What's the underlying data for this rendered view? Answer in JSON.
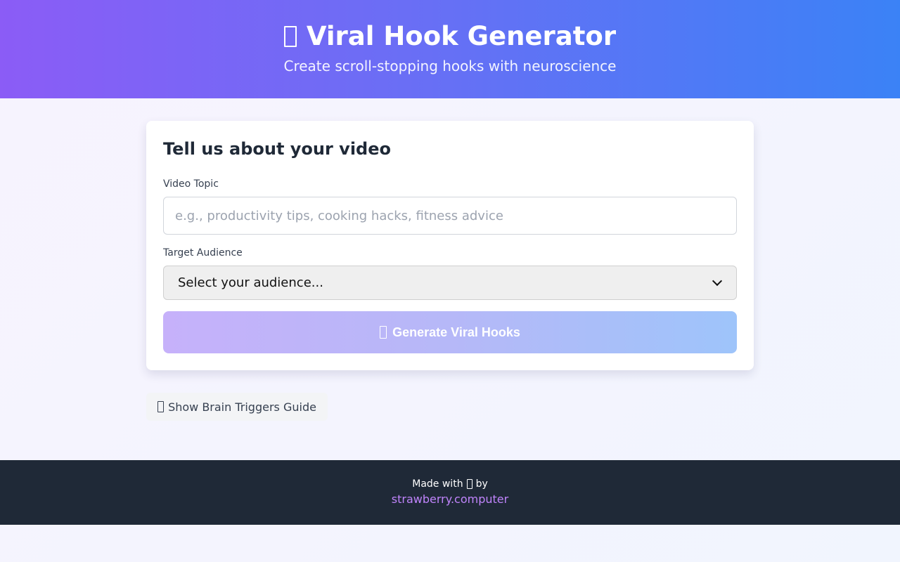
{
  "header": {
    "title": "Viral Hook Generator",
    "subtitle": "Create scroll-stopping hooks with neuroscience",
    "title_icon": "glyph-box-icon"
  },
  "form": {
    "heading": "Tell us about your video",
    "topic_label": "Video Topic",
    "topic_placeholder": "e.g., productivity tips, cooking hacks, fitness advice",
    "topic_value": "",
    "audience_label": "Target Audience",
    "audience_selected": "Select your audience...",
    "generate_label": "Generate Viral Hooks"
  },
  "guide": {
    "toggle_label": "Show Brain Triggers Guide"
  },
  "footer": {
    "made_with": "Made with",
    "by": "by",
    "link_text": "strawberry.computer"
  },
  "colors": {
    "header_start": "#8b5cf6",
    "header_end": "#3b82f6",
    "footer_bg": "#1f2937",
    "link": "#c084fc"
  }
}
